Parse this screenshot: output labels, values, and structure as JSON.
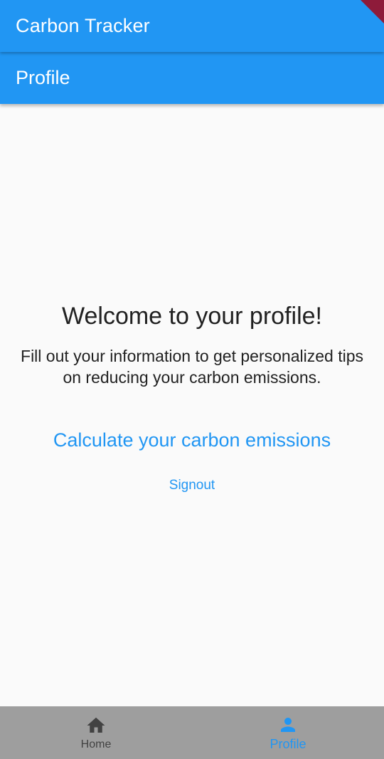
{
  "app": {
    "title": "Carbon Tracker"
  },
  "page": {
    "title": "Profile"
  },
  "main": {
    "welcome": "Welcome to your profile!",
    "description": "Fill out your information to get personalized tips on reducing your carbon emissions.",
    "calculate_label": "Calculate your carbon emissions",
    "signout_label": "Signout"
  },
  "bottom_nav": {
    "items": [
      {
        "label": "Home",
        "icon": "home-icon",
        "selected": false
      },
      {
        "label": "Profile",
        "icon": "person-icon",
        "selected": true
      }
    ]
  },
  "colors": {
    "primary": "#2196f3",
    "background": "#fafafa",
    "bottom_nav": "#9e9e9e",
    "text": "#212121",
    "debug_banner": "#8e1b3a"
  }
}
